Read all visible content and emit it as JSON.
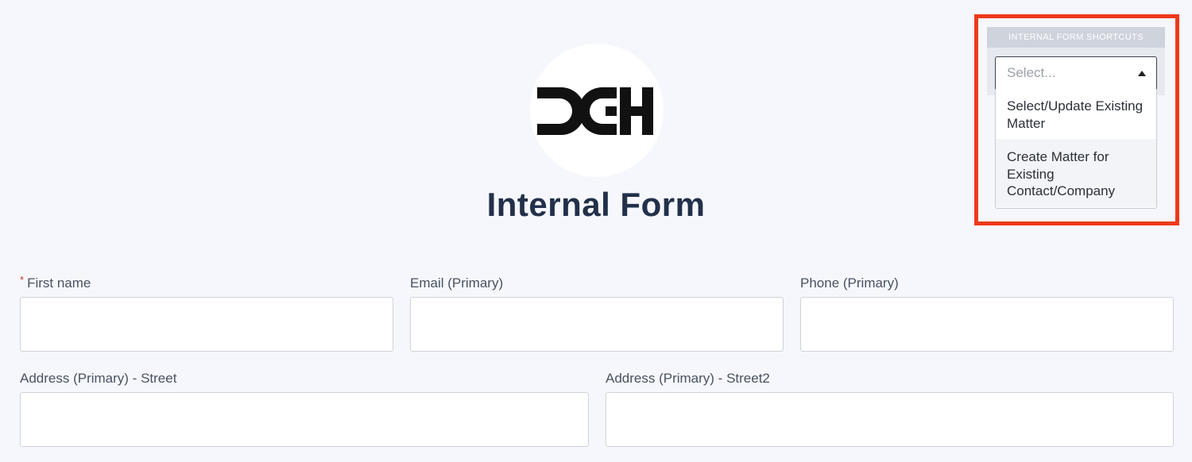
{
  "title": "Internal Form",
  "logo": {
    "text": "DGH"
  },
  "shortcuts": {
    "header": "INTERNAL FORM SHORTCUTS",
    "placeholder": "Select...",
    "options": [
      "Select/Update Existing Matter",
      "Create Matter for Existing Contact/Company"
    ]
  },
  "fields": {
    "first_name": {
      "label": "First name",
      "required_mark": "*",
      "value": ""
    },
    "email": {
      "label": "Email (Primary)",
      "value": ""
    },
    "phone": {
      "label": "Phone (Primary)",
      "value": ""
    },
    "street": {
      "label": "Address (Primary) - Street",
      "value": ""
    },
    "street2": {
      "label": "Address (Primary) - Street2",
      "value": ""
    }
  },
  "colors": {
    "highlight": "#ee3a1a",
    "title": "#22304a",
    "required": "#c0392b"
  }
}
